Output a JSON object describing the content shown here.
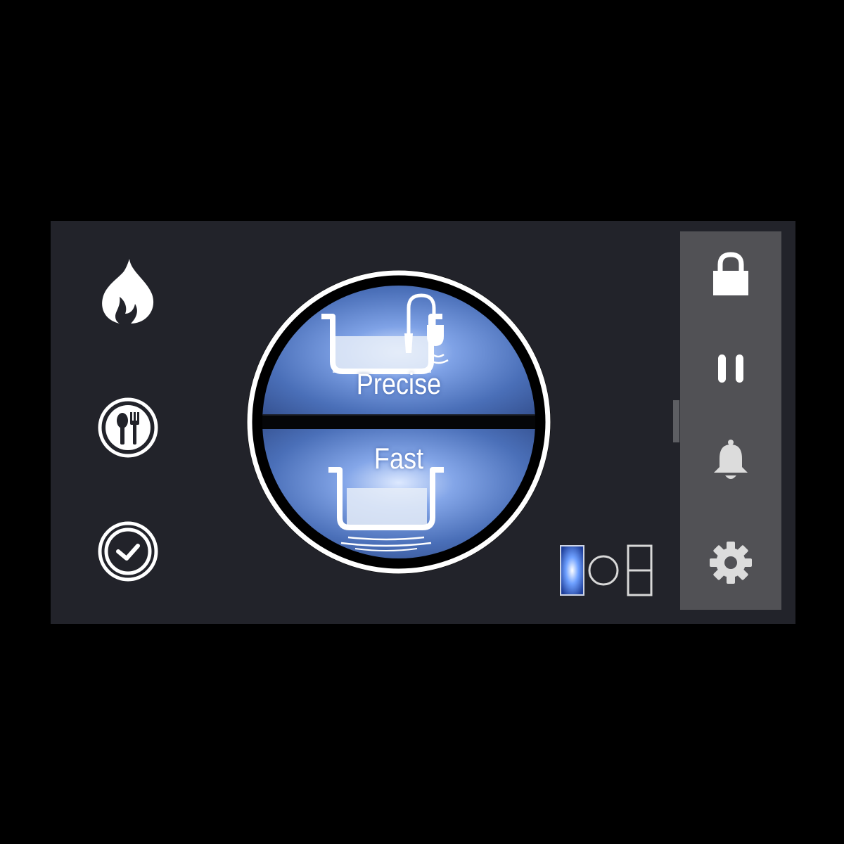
{
  "app": {
    "colors": {
      "background": "#000000",
      "screen": "#22232a",
      "panel": "#515155",
      "accent_blue": "#4a6fb8",
      "icon_white": "#ffffff",
      "icon_grey": "#d8d8d8"
    }
  },
  "left_menu": {
    "items": [
      {
        "icon": "flame-icon"
      },
      {
        "icon": "plate-cutlery-icon"
      },
      {
        "icon": "clock-icon"
      }
    ]
  },
  "modes": {
    "top": {
      "label": "Precise",
      "icon": "pot-with-sensor-icon"
    },
    "bottom": {
      "label": "Fast",
      "icon": "pot-on-burner-icon"
    }
  },
  "layout_toggle": {
    "icon": "zone-layout-icon",
    "options": [
      "flex-zone",
      "round-zone",
      "split-zone"
    ],
    "selected": "flex-zone"
  },
  "right_panel": {
    "items": [
      {
        "icon": "lock-icon"
      },
      {
        "icon": "pause-icon"
      },
      {
        "icon": "bell-icon"
      },
      {
        "icon": "gear-icon"
      }
    ]
  }
}
